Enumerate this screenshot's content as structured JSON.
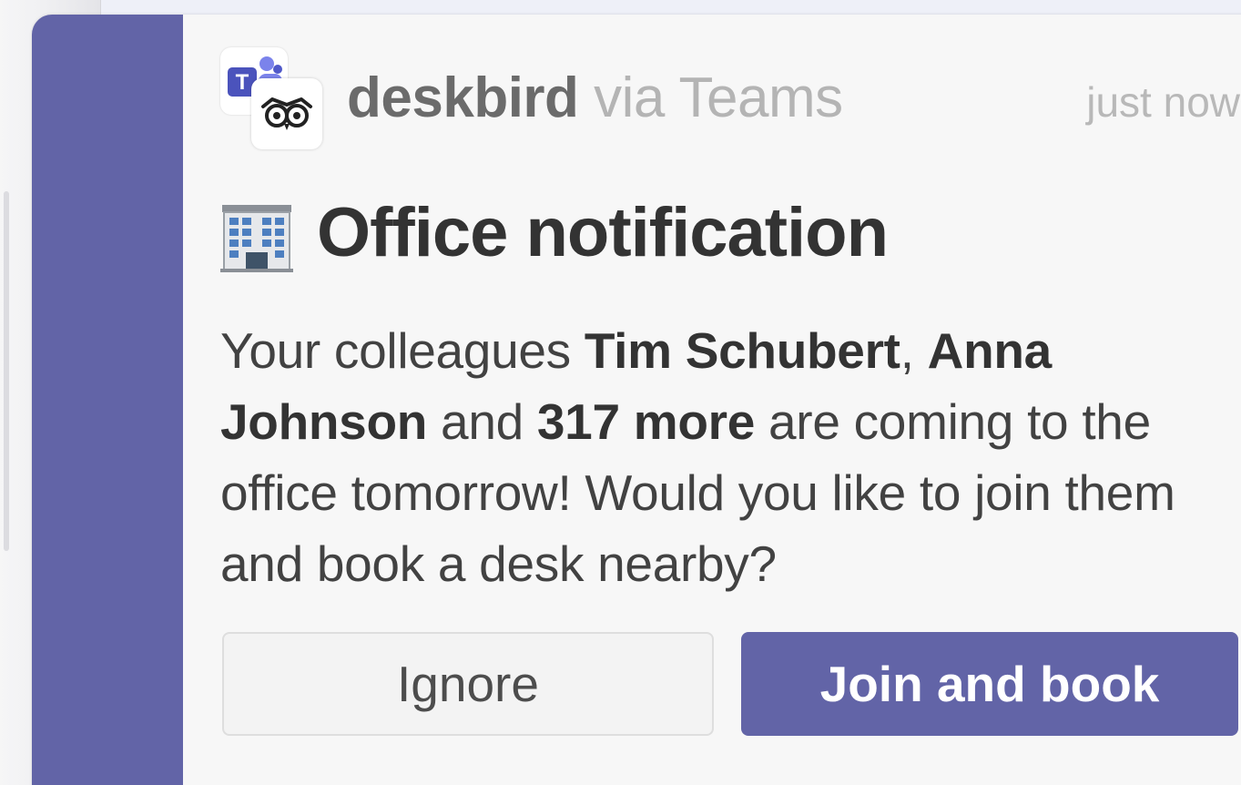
{
  "notification": {
    "app_name": "deskbird",
    "via_text": "via Teams",
    "timestamp": "just now",
    "title": "Office notification",
    "message_parts": {
      "p1": "Your colleagues ",
      "name1": "Tim Schubert",
      "p2": ", ",
      "name2": "Anna Johnson",
      "p3": " and ",
      "count": "317 more",
      "p4": " are coming to the office tomorrow! Would you like to join them and book a desk nearby?"
    },
    "buttons": {
      "ignore": "Ignore",
      "join": "Join and book"
    }
  },
  "icons": {
    "source_app": "teams-icon",
    "bot_app": "deskbird-owl-icon",
    "title_emoji": "office-building-icon"
  },
  "colors": {
    "accent": "#6264a7",
    "card_background": "#f7f7f7",
    "title_text": "#333333",
    "muted_text": "#b4b4b4"
  }
}
